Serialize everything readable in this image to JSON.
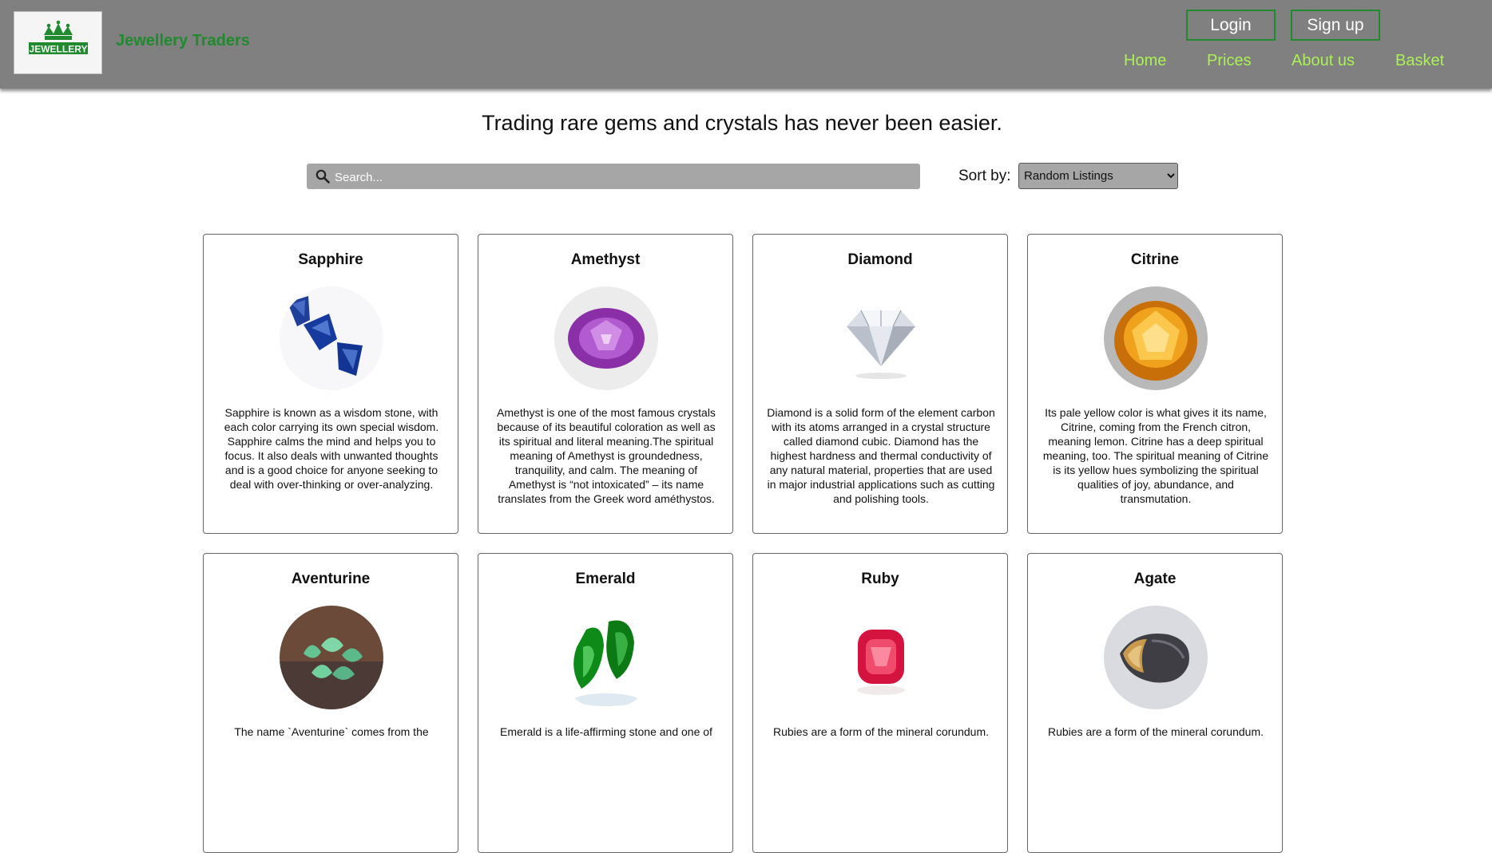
{
  "brand": {
    "name": "Jewellery Traders",
    "logo_text": "JEWELLERY"
  },
  "auth": {
    "login_label": "Login",
    "signup_label": "Sign up"
  },
  "nav": {
    "home": "Home",
    "prices": "Prices",
    "about": "About us",
    "basket": "Basket"
  },
  "tagline": "Trading rare gems and crystals has never been easier.",
  "search": {
    "placeholder": "Search...",
    "value": ""
  },
  "sort": {
    "label": "Sort by:",
    "selected": "Random Listings"
  },
  "colors": {
    "header_bg": "#808080",
    "brand_green": "#1f8a2e",
    "nav_link": "#aaf056",
    "search_bg": "#a6a6a6"
  },
  "products": [
    {
      "name": "Sapphire",
      "image": "sapphire-image",
      "description": "Sapphire is known as a wisdom stone, with each color carrying its own special wisdom. Sapphire calms the mind and helps you to focus. It also deals with unwanted thoughts and is a good choice for anyone seeking to deal with over-thinking or over-analyzing."
    },
    {
      "name": "Amethyst",
      "image": "amethyst-image",
      "description": "Amethyst is one of the most famous crystals because of its beautiful coloration as well as its spiritual and literal meaning.The spiritual meaning of Amethyst is groundedness, tranquility, and calm. The meaning of Amethyst is “not intoxicated” – its name translates from the Greek word améthystos."
    },
    {
      "name": "Diamond",
      "image": "diamond-image",
      "description": "Diamond is a solid form of the element carbon with its atoms arranged in a crystal structure called diamond cubic. Diamond has the highest hardness and thermal conductivity of any natural material, properties that are used in major industrial applications such as cutting and polishing tools."
    },
    {
      "name": "Citrine",
      "image": "citrine-image",
      "description": "Its pale yellow color is what gives it its name, Citrine, coming from the French citron, meaning lemon. Citrine has a deep spiritual meaning, too. The spiritual meaning of Citrine is its yellow hues symbolizing the spiritual qualities of joy, abundance, and transmutation."
    },
    {
      "name": "Aventurine",
      "image": "aventurine-image",
      "description": "The name `Aventurine` comes from the"
    },
    {
      "name": "Emerald",
      "image": "emerald-image",
      "description": "Emerald is a life-affirming stone and one of"
    },
    {
      "name": "Ruby",
      "image": "ruby-image",
      "description": "Rubies are a form of the mineral corundum."
    },
    {
      "name": "Agate",
      "image": "agate-image",
      "description": "Rubies are a form of the mineral corundum."
    }
  ]
}
